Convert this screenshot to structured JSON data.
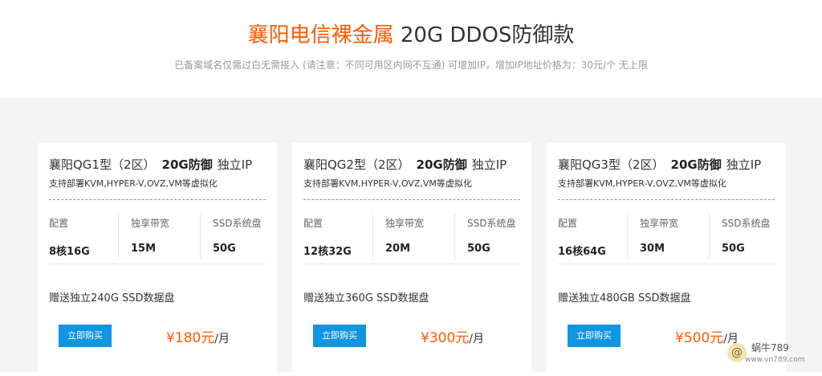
{
  "header": {
    "title_accent": "襄阳电信裸金属",
    "title_rest": " 20G DDOS防御款",
    "subtitle": "已备案域名仅需过白无需接入 (请注意：不同可用区内网不互通) 可增加IP，增加IP地址价格为：30元/个 无上限"
  },
  "spec_labels": {
    "config": "配置",
    "bandwidth": "独享带宽",
    "disk": "SSD系统盘"
  },
  "cards": [
    {
      "name": "襄阳QG1型（2区）",
      "protection": "20G防御",
      "ip": "独立IP",
      "support": "支持部署KVM,HYPER-V,OVZ,VM等虚拟化",
      "config": "8核16G",
      "bandwidth": "15M",
      "disk": "50G",
      "gift": "赠送独立240G SSD数据盘",
      "buy_label": "立即购买",
      "price": "¥180元",
      "unit": "/月"
    },
    {
      "name": "襄阳QG2型（2区）",
      "protection": "20G防御",
      "ip": "独立IP",
      "support": "支持部署KVM,HYPER-V,OVZ,VM等虚拟化",
      "config": "12核32G",
      "bandwidth": "20M",
      "disk": "50G",
      "gift": "赠送独立360G SSD数据盘",
      "buy_label": "立即购买",
      "price": "¥300元",
      "unit": "/月"
    },
    {
      "name": "襄阳QG3型（2区）",
      "protection": "20G防御",
      "ip": "独立IP",
      "support": "支持部署KVM,HYPER-V,OVZ,VM等虚拟化",
      "config": "16核64G",
      "bandwidth": "30M",
      "disk": "50G",
      "gift": "赠送独立480GB SSD数据盘",
      "buy_label": "立即购买",
      "price": "¥500元",
      "unit": "/月"
    }
  ],
  "watermark": {
    "name": "蜗牛789",
    "url": "www.vn789.com",
    "icon": "snail-icon"
  },
  "colors": {
    "accent": "#ff5a00",
    "button": "#1195e0",
    "background": "#f4f4f4"
  }
}
